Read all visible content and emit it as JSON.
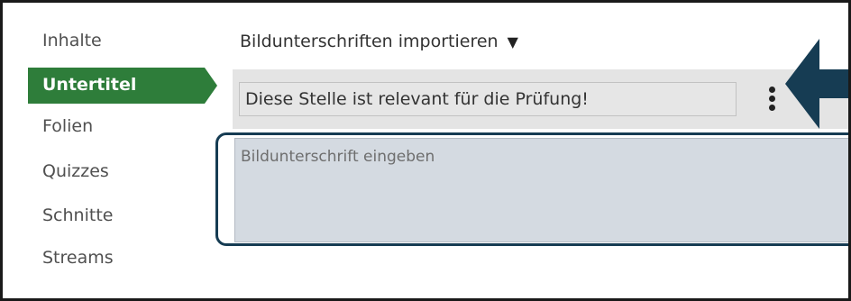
{
  "sidebar": {
    "items": [
      {
        "label": "Inhalte"
      },
      {
        "label": "Untertitel",
        "active": true
      },
      {
        "label": "Folien"
      },
      {
        "label": "Quizzes"
      },
      {
        "label": "Schnitte"
      },
      {
        "label": "Streams"
      }
    ],
    "active_color": "#2e7d3a"
  },
  "header": {
    "import_label": "Bildunterschriften importieren",
    "import_caret_icon": "caret-down-icon"
  },
  "caption": {
    "text": "Diese Stelle ist relevant für die Prüfung!",
    "menu_icon": "kebab-menu-icon"
  },
  "editor": {
    "placeholder": "Bildunterschrift eingeben",
    "value": ""
  },
  "annotation": {
    "arrow_color": "#163c53",
    "highlight_color": "#163c53"
  }
}
